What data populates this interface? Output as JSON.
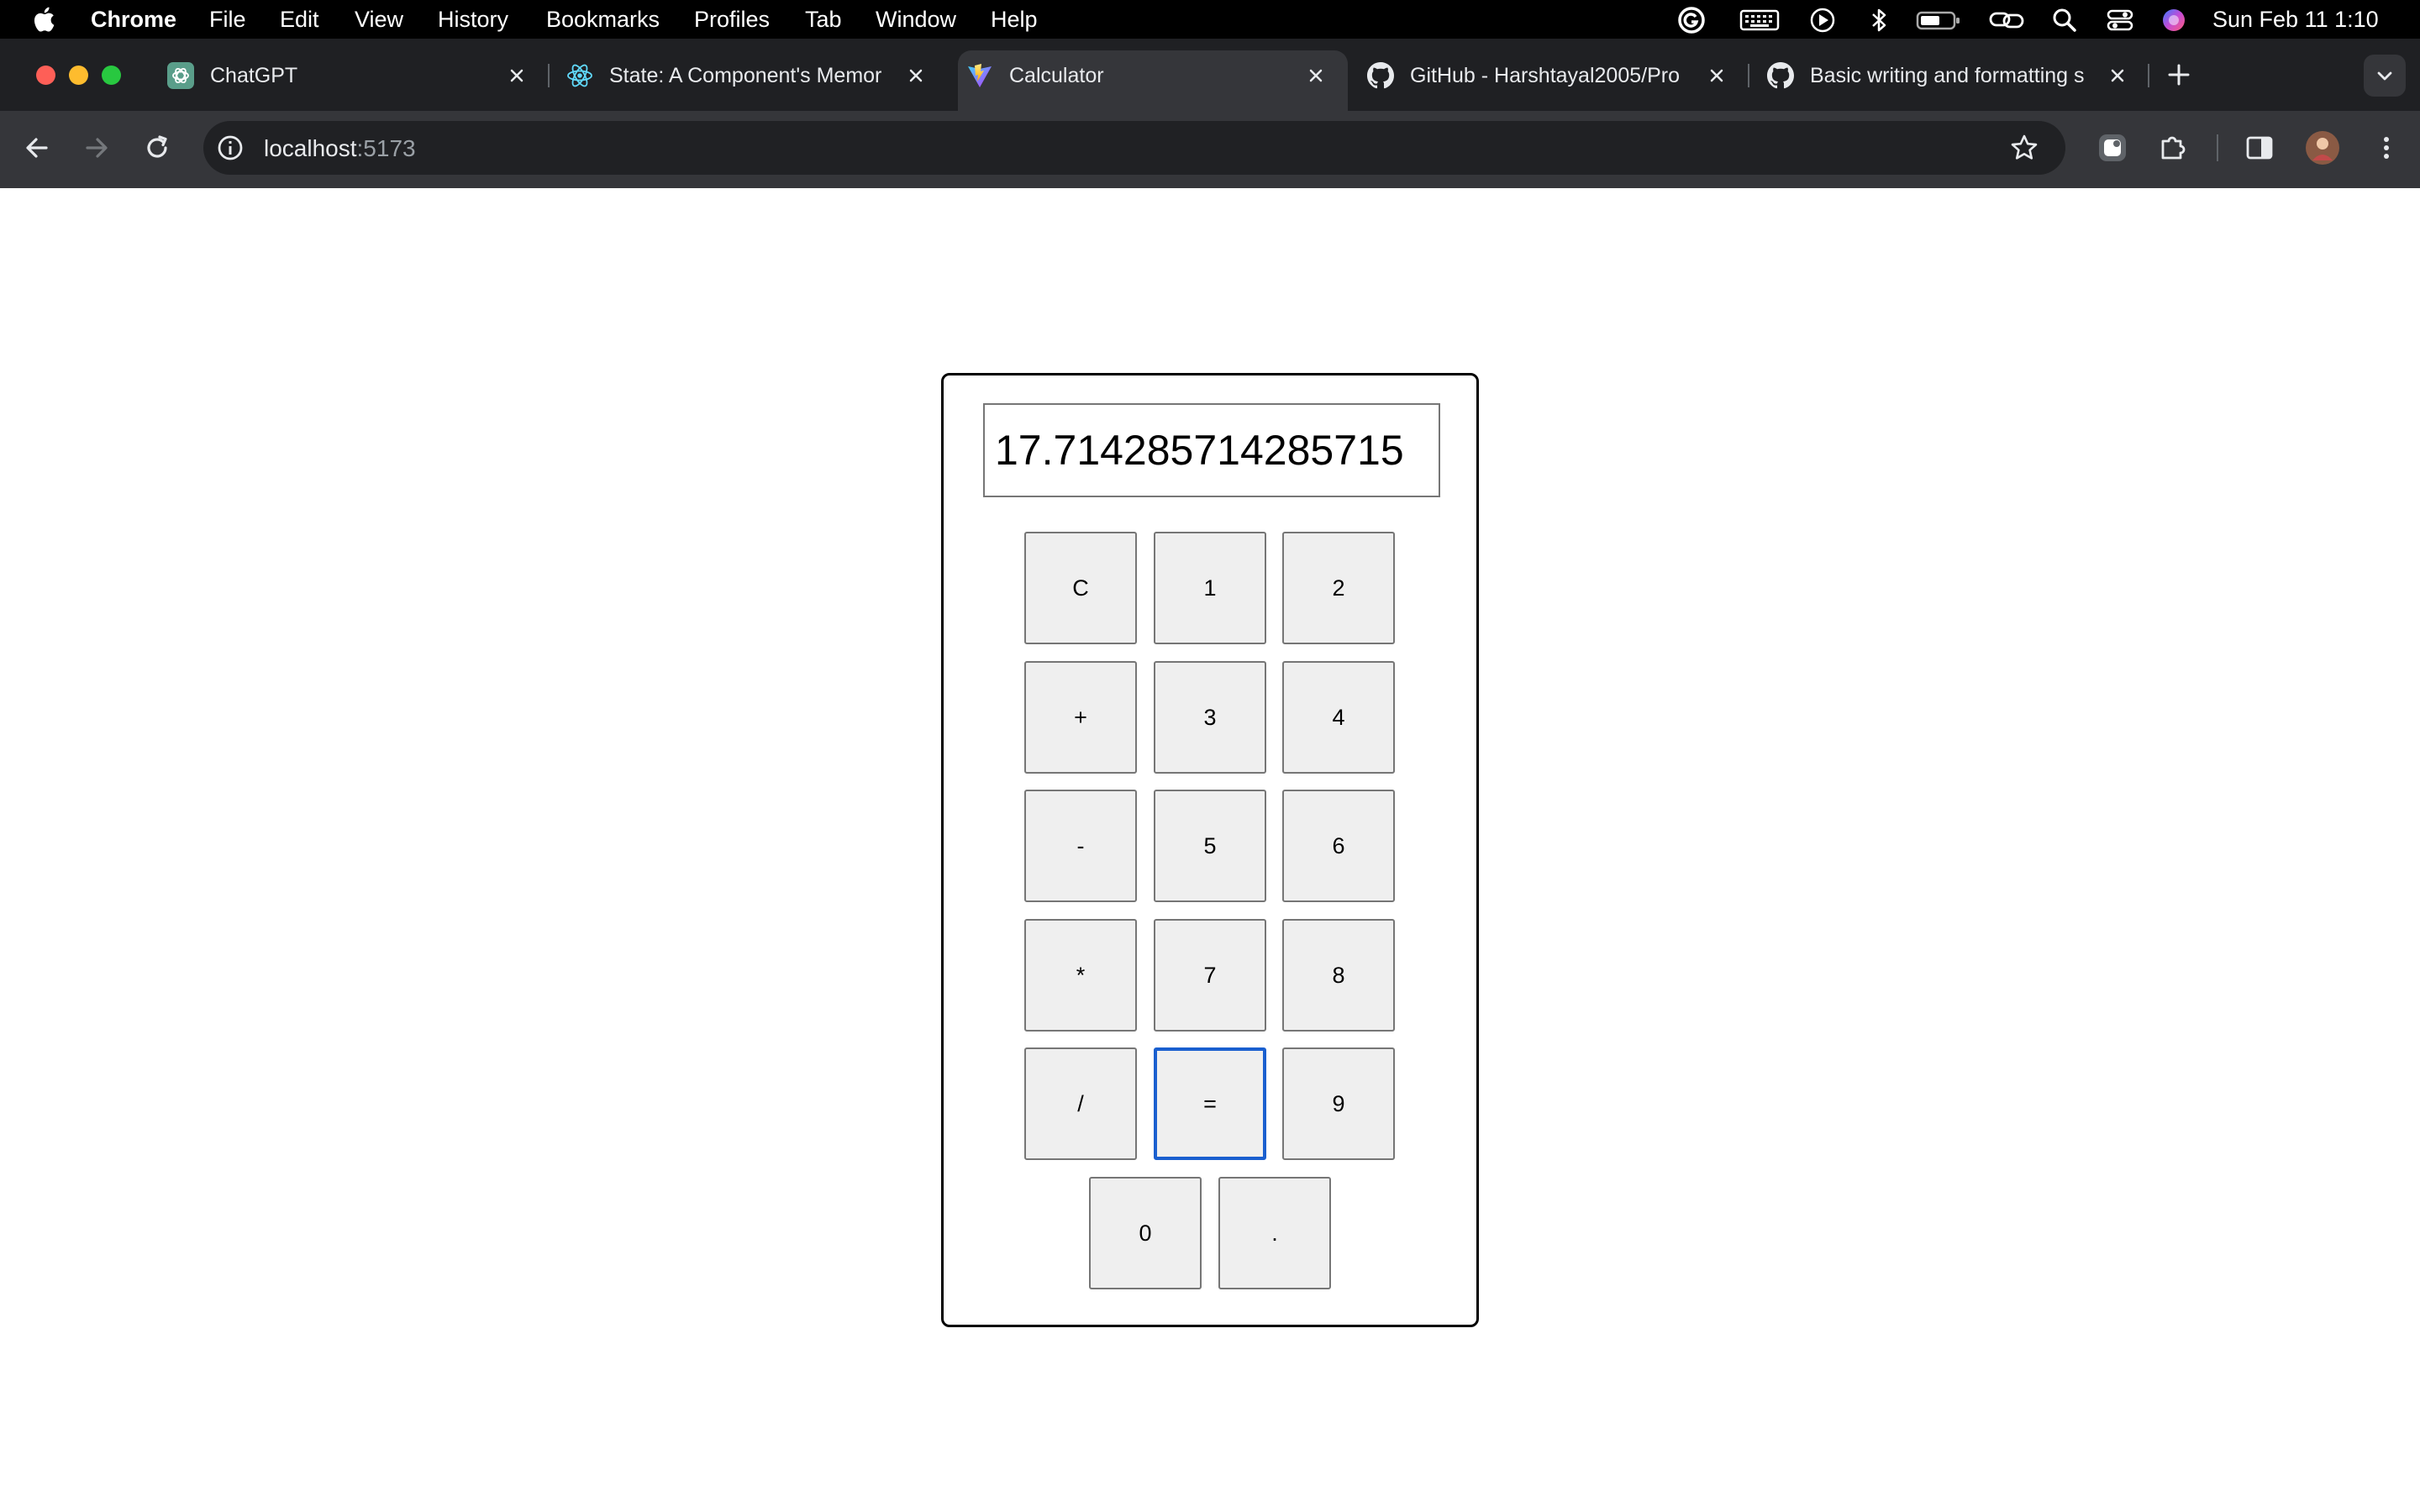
{
  "menubar": {
    "app_name": "Chrome",
    "menus": [
      "File",
      "Edit",
      "View",
      "History",
      "Bookmarks",
      "Profiles",
      "Tab",
      "Window",
      "Help"
    ],
    "clock": "Sun Feb 11  1:10",
    "status_icons": [
      "grammarly-icon",
      "keyboard-icon",
      "play-icon",
      "bluetooth-icon",
      "battery-icon",
      "link-icon",
      "search-icon",
      "control-center-icon",
      "siri-icon"
    ]
  },
  "tabs": [
    {
      "title": "ChatGPT",
      "icon": "chatgpt-icon",
      "active": false
    },
    {
      "title": "State: A Component's Memor",
      "icon": "react-icon",
      "active": false
    },
    {
      "title": "Calculator",
      "icon": "vite-icon",
      "active": true
    },
    {
      "title": "GitHub - Harshtayal2005/Pro",
      "icon": "github-icon",
      "active": false
    },
    {
      "title": "Basic writing and formatting s",
      "icon": "github-icon",
      "active": false
    }
  ],
  "toolbar": {
    "url_host": "localhost",
    "url_port": ":5173"
  },
  "calculator": {
    "display": "17.714285714285715",
    "keys": [
      "C",
      "1",
      "2",
      "+",
      "3",
      "4",
      "-",
      "5",
      "6",
      "*",
      "7",
      "8",
      "/",
      "=",
      "9",
      "0",
      "."
    ],
    "focused_key": "="
  },
  "colors": {
    "menubar_bg": "#000000",
    "tabstrip_bg": "#1f2023",
    "toolbar_bg": "#35363a",
    "omnibox_bg": "#202124",
    "key_bg": "#efefef",
    "focus_ring": "#1a5fcf"
  }
}
